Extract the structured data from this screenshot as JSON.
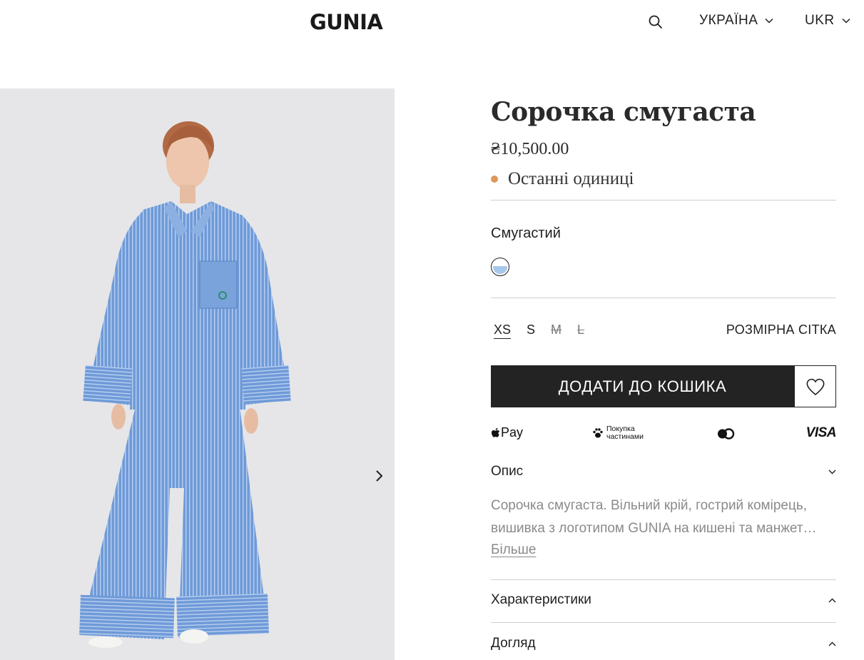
{
  "header": {
    "logo": "GUNIA",
    "country": "УКРАЇНА",
    "language": "UKR",
    "icons": [
      "search-icon",
      "chevron-down-icon"
    ]
  },
  "product": {
    "title": "Сорочка смугаста",
    "price": "₴10,500.00",
    "stock_status": "Останні одиниці",
    "stock_dot_color": "#e0965a",
    "color_name": "Смугастий",
    "swatch_colors": [
      "#ffffff",
      "#a7c8ea"
    ],
    "sizes": [
      {
        "label": "XS",
        "state": "selected"
      },
      {
        "label": "S",
        "state": "available"
      },
      {
        "label": "M",
        "state": "unavailable"
      },
      {
        "label": "L",
        "state": "unavailable"
      }
    ],
    "size_guide": "РОЗМІРНА СІТКА",
    "add_to_cart": "ДОДАТИ ДО КОШИКА"
  },
  "payments": {
    "apple_pay": "Pay",
    "parts_line1": "Покупка",
    "parts_line2": "частинами",
    "visa": "VISA"
  },
  "accordion": {
    "description_title": "Опис",
    "description_line1": "Сорочка смугаста. Вільний крій, гострий комірець,",
    "description_line2": "вишивка з логотипом GUNIA на кишені та манжет…",
    "more": "Більше",
    "specs_title": "Характеристики",
    "care_title": "Догляд"
  },
  "colors": {
    "button_bg": "#232323",
    "gallery_bg": "#e6e6e8",
    "garment": "#6f9ad8"
  }
}
